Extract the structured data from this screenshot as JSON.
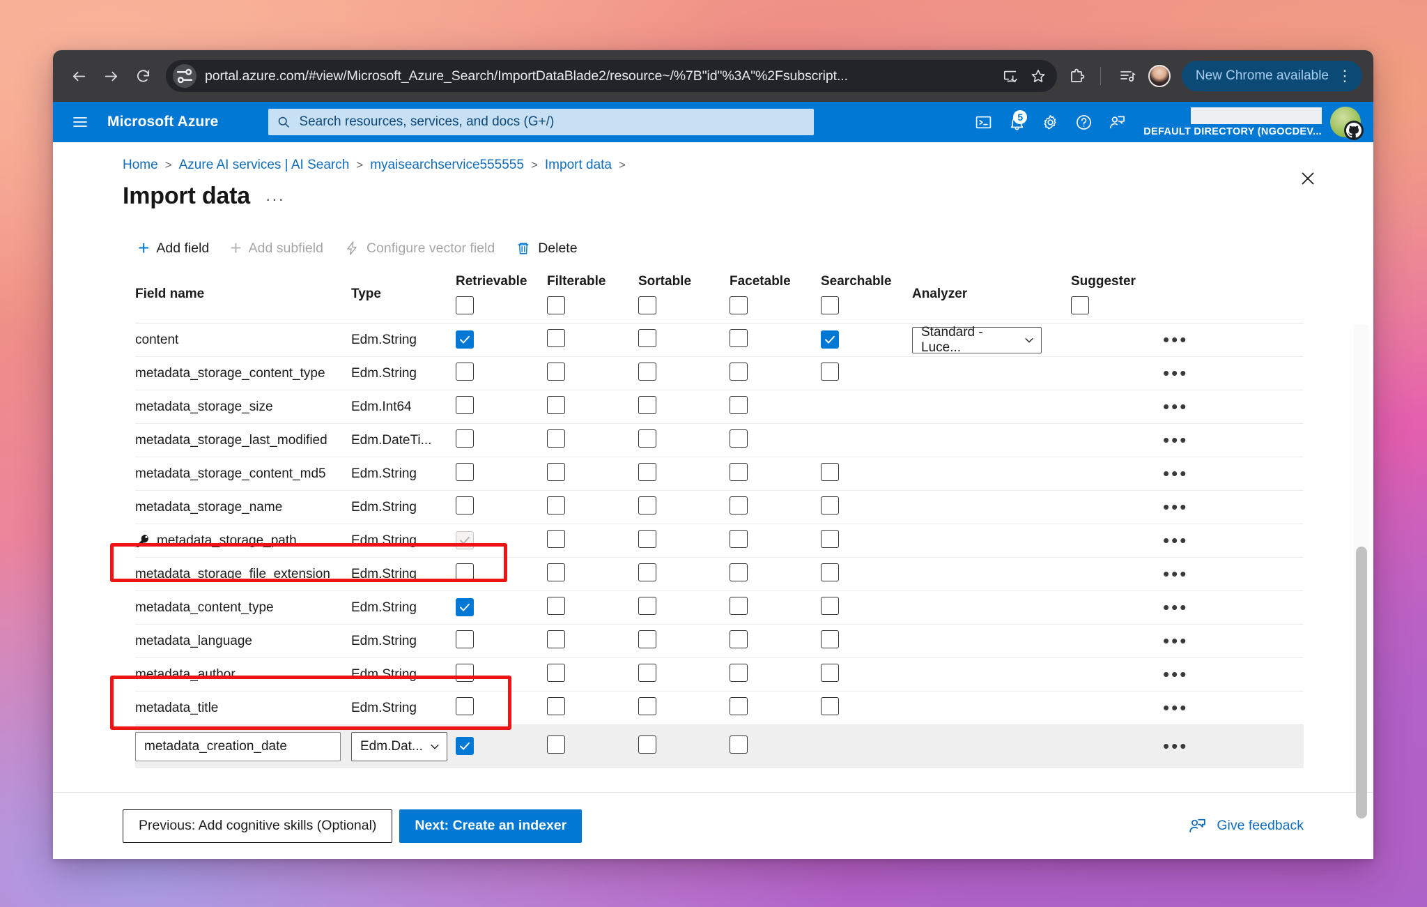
{
  "browser": {
    "url": "portal.azure.com/#view/Microsoft_Azure_Search/ImportDataBlade2/resource~/%7B\"id\"%3A\"%2Fsubscript...",
    "new_chrome_label": "New Chrome available"
  },
  "azure_header": {
    "brand": "Microsoft Azure",
    "search_placeholder": "Search resources, services, and docs (G+/)",
    "notification_count": "5",
    "tenant": "DEFAULT DIRECTORY (NGOCDEV..."
  },
  "breadcrumb": [
    {
      "label": "Home"
    },
    {
      "label": "Azure AI services | AI Search"
    },
    {
      "label": "myaisearchservice555555"
    },
    {
      "label": "Import data"
    }
  ],
  "page": {
    "title": "Import data",
    "ellipsis": "···"
  },
  "command_bar": [
    {
      "label": "Add field",
      "icon": "plus-icon",
      "disabled": false
    },
    {
      "label": "Add subfield",
      "icon": "plus-icon",
      "disabled": true
    },
    {
      "label": "Configure vector field",
      "icon": "lightning-icon",
      "disabled": true
    },
    {
      "label": "Delete",
      "icon": "trash-icon",
      "disabled": false
    }
  ],
  "table": {
    "headers": {
      "field_name": "Field name",
      "type": "Type",
      "retrievable": "Retrievable",
      "filterable": "Filterable",
      "sortable": "Sortable",
      "facetable": "Facetable",
      "searchable": "Searchable",
      "analyzer": "Analyzer",
      "suggester": "Suggester"
    },
    "header_checks": {
      "retrievable": false,
      "filterable": false,
      "sortable": false,
      "facetable": false,
      "searchable": false,
      "suggester": false
    },
    "row_menu_glyph": "•••",
    "rows": [
      {
        "name": "content",
        "type": "Edm.String",
        "key": false,
        "retrievable": "checked",
        "filterable": "unchecked",
        "sortable": "unchecked",
        "facetable": "unchecked",
        "searchable": "checked",
        "analyzer": "Standard - Luce...",
        "suggester": "none"
      },
      {
        "name": "metadata_storage_content_type",
        "type": "Edm.String",
        "key": false,
        "retrievable": "unchecked",
        "filterable": "unchecked",
        "sortable": "unchecked",
        "facetable": "unchecked",
        "searchable": "unchecked",
        "analyzer": "",
        "suggester": "none"
      },
      {
        "name": "metadata_storage_size",
        "type": "Edm.Int64",
        "key": false,
        "retrievable": "unchecked",
        "filterable": "unchecked",
        "sortable": "unchecked",
        "facetable": "unchecked",
        "searchable": "none",
        "analyzer": "",
        "suggester": "none"
      },
      {
        "name": "metadata_storage_last_modified",
        "type": "Edm.DateTi...",
        "key": false,
        "retrievable": "unchecked",
        "filterable": "unchecked",
        "sortable": "unchecked",
        "facetable": "unchecked",
        "searchable": "none",
        "analyzer": "",
        "suggester": "none"
      },
      {
        "name": "metadata_storage_content_md5",
        "type": "Edm.String",
        "key": false,
        "retrievable": "unchecked",
        "filterable": "unchecked",
        "sortable": "unchecked",
        "facetable": "unchecked",
        "searchable": "unchecked",
        "analyzer": "",
        "suggester": "none"
      },
      {
        "name": "metadata_storage_name",
        "type": "Edm.String",
        "key": false,
        "retrievable": "unchecked",
        "filterable": "unchecked",
        "sortable": "unchecked",
        "facetable": "unchecked",
        "searchable": "unchecked",
        "analyzer": "",
        "suggester": "none"
      },
      {
        "name": "metadata_storage_path",
        "type": "Edm.String",
        "key": true,
        "retrievable": "disabled-checked",
        "filterable": "unchecked",
        "sortable": "unchecked",
        "facetable": "unchecked",
        "searchable": "unchecked",
        "analyzer": "",
        "suggester": "none"
      },
      {
        "name": "metadata_storage_file_extension",
        "type": "Edm.String",
        "key": false,
        "retrievable": "unchecked",
        "filterable": "unchecked",
        "sortable": "unchecked",
        "facetable": "unchecked",
        "searchable": "unchecked",
        "analyzer": "",
        "suggester": "none"
      },
      {
        "name": "metadata_content_type",
        "type": "Edm.String",
        "key": false,
        "retrievable": "checked",
        "filterable": "unchecked",
        "sortable": "unchecked",
        "facetable": "unchecked",
        "searchable": "unchecked",
        "analyzer": "",
        "suggester": "none"
      },
      {
        "name": "metadata_language",
        "type": "Edm.String",
        "key": false,
        "retrievable": "unchecked",
        "filterable": "unchecked",
        "sortable": "unchecked",
        "facetable": "unchecked",
        "searchable": "unchecked",
        "analyzer": "",
        "suggester": "none"
      },
      {
        "name": "metadata_author",
        "type": "Edm.String",
        "key": false,
        "retrievable": "unchecked",
        "filterable": "unchecked",
        "sortable": "unchecked",
        "facetable": "unchecked",
        "searchable": "unchecked",
        "analyzer": "",
        "suggester": "none"
      },
      {
        "name": "metadata_title",
        "type": "Edm.String",
        "key": false,
        "retrievable": "unchecked",
        "filterable": "unchecked",
        "sortable": "unchecked",
        "facetable": "unchecked",
        "searchable": "unchecked",
        "analyzer": "",
        "suggester": "none"
      }
    ],
    "edit_row": {
      "name_value": "metadata_creation_date",
      "type_value": "Edm.Dat...",
      "retrievable": "checked",
      "filterable": "unchecked",
      "sortable": "unchecked",
      "facetable": "unchecked",
      "searchable": "none",
      "analyzer": "",
      "suggester": "none"
    }
  },
  "footer": {
    "previous_label": "Previous: Add cognitive skills (Optional)",
    "next_label": "Next: Create an indexer",
    "feedback_label": "Give feedback"
  },
  "colors": {
    "azure_blue": "#0078d4",
    "link_blue": "#0f6cbd",
    "highlight_red": "#ee1414"
  }
}
